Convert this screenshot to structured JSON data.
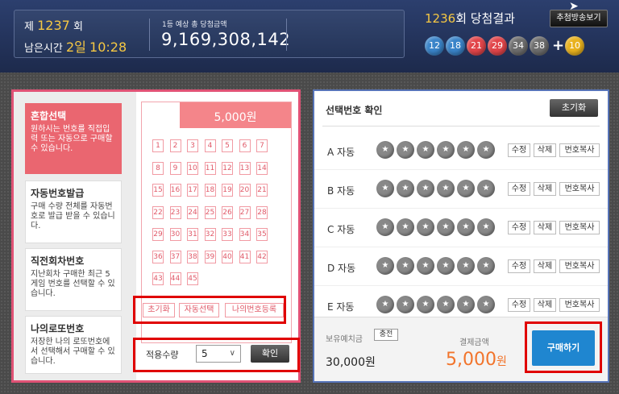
{
  "header": {
    "round_prefix": "제",
    "round_number": "1237",
    "round_suffix": "회",
    "remaining_label": "남은시간",
    "remaining_days": "2일",
    "remaining_time": "10:28",
    "prize_label": "1등 예상 총 당첨금액",
    "prize_amount": "9,169,308,142",
    "result_round": "1236",
    "result_suffix": "회 당첨결과",
    "video_button": "추첨방송보기",
    "winning_numbers": [
      "12",
      "18",
      "21",
      "29",
      "34",
      "38"
    ],
    "bonus_number": "10",
    "ball_colors": {
      "12": "#3a84c9",
      "18": "#3a84c9",
      "21": "#e2454a",
      "29": "#e2454a",
      "34": "#6d6d6d",
      "38": "#6d6d6d",
      "10": "#e9b21e"
    }
  },
  "tabs": [
    {
      "title": "혼합선택",
      "desc": "원하시는 번호를 직접입력 또는 자동으로 구매할 수 있습니다.",
      "active": true
    },
    {
      "title": "자동번호발급",
      "desc": "구매 수량 전체를 자동번호로 발급 받을 수 있습니다.",
      "active": false
    },
    {
      "title": "직전회차번호",
      "desc": "지난회차 구매한 최근 5게임 번호를 선택할 수 있습니다.",
      "active": false
    },
    {
      "title": "나의로또번호",
      "desc": "저장한 나의 로또번호에서 선택해서 구매할 수 있습니다.",
      "active": false
    }
  ],
  "slip": {
    "price": "5,000원",
    "numbers": [
      "1",
      "2",
      "3",
      "4",
      "5",
      "6",
      "7",
      "8",
      "9",
      "10",
      "11",
      "12",
      "13",
      "14",
      "15",
      "16",
      "17",
      "18",
      "19",
      "20",
      "21",
      "22",
      "23",
      "24",
      "25",
      "26",
      "27",
      "28",
      "29",
      "30",
      "31",
      "32",
      "33",
      "34",
      "35",
      "36",
      "37",
      "38",
      "39",
      "40",
      "41",
      "42",
      "43",
      "44",
      "45"
    ],
    "reset_button": "초기화",
    "auto_button": "자동선택",
    "mynum_button": "나의번호등록"
  },
  "quantity": {
    "label": "적용수량",
    "value": "5",
    "apply_button": "확인"
  },
  "confirm": {
    "title": "선택번호 확인",
    "reset_button": "초기화",
    "rows": [
      {
        "label": "A 자동"
      },
      {
        "label": "B 자동"
      },
      {
        "label": "C 자동"
      },
      {
        "label": "D 자동"
      },
      {
        "label": "E 자동"
      }
    ],
    "star": "★",
    "edit_button": "수정",
    "delete_button": "삭제",
    "copy_button": "번호복사"
  },
  "footer": {
    "deposit_label": "보유예치금",
    "charge_button": "충전",
    "deposit_amount": "30,000원",
    "pay_label": "결제금액",
    "pay_amount": "5,000",
    "pay_unit": "원",
    "buy_button": "구매하기"
  }
}
